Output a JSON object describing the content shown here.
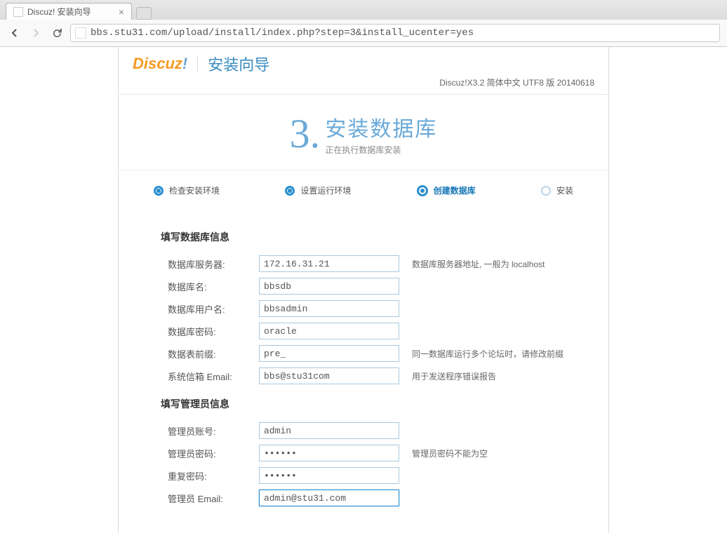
{
  "browser": {
    "tab_title": "Discuz! 安装向导",
    "url_display": "bbs.stu31.com/upload/install/index.php?step=3&install_ucenter=yes"
  },
  "header": {
    "logo_main": "Discuz",
    "logo_bang": "!",
    "subtitle": "安装向导",
    "version": "Discuz!X3.2 简体中文 UTF8 版 20140618"
  },
  "hero": {
    "number": "3.",
    "title": "安装数据库",
    "subtitle": "正在执行数据库安装"
  },
  "steps": {
    "s1": "检查安装环境",
    "s2": "设置运行环境",
    "s3": "创建数据库",
    "s4": "安装"
  },
  "sections": {
    "db_title": "填写数据库信息",
    "admin_title": "填写管理员信息"
  },
  "db": {
    "server_label": "数据库服务器:",
    "server_value": "172.16.31.21",
    "server_hint": "数据库服务器地址, 一般为 localhost",
    "name_label": "数据库名:",
    "name_value": "bbsdb",
    "user_label": "数据库用户名:",
    "user_value": "bbsadmin",
    "pass_label": "数据库密码:",
    "pass_value": "oracle",
    "prefix_label": "数据表前缀:",
    "prefix_value": "pre_",
    "prefix_hint": "同一数据库运行多个论坛时，请修改前缀",
    "email_label": "系统信箱 Email:",
    "email_value": "bbs@stu31com",
    "email_hint": "用于发送程序错误报告"
  },
  "admin": {
    "user_label": "管理员账号:",
    "user_value": "admin",
    "pass_label": "管理员密码:",
    "pass_value": "••••••",
    "pass_hint": "管理员密码不能为空",
    "repass_label": "重复密码:",
    "repass_value": "••••••",
    "email_label": "管理员 Email:",
    "email_value": "admin@stu31.com"
  }
}
